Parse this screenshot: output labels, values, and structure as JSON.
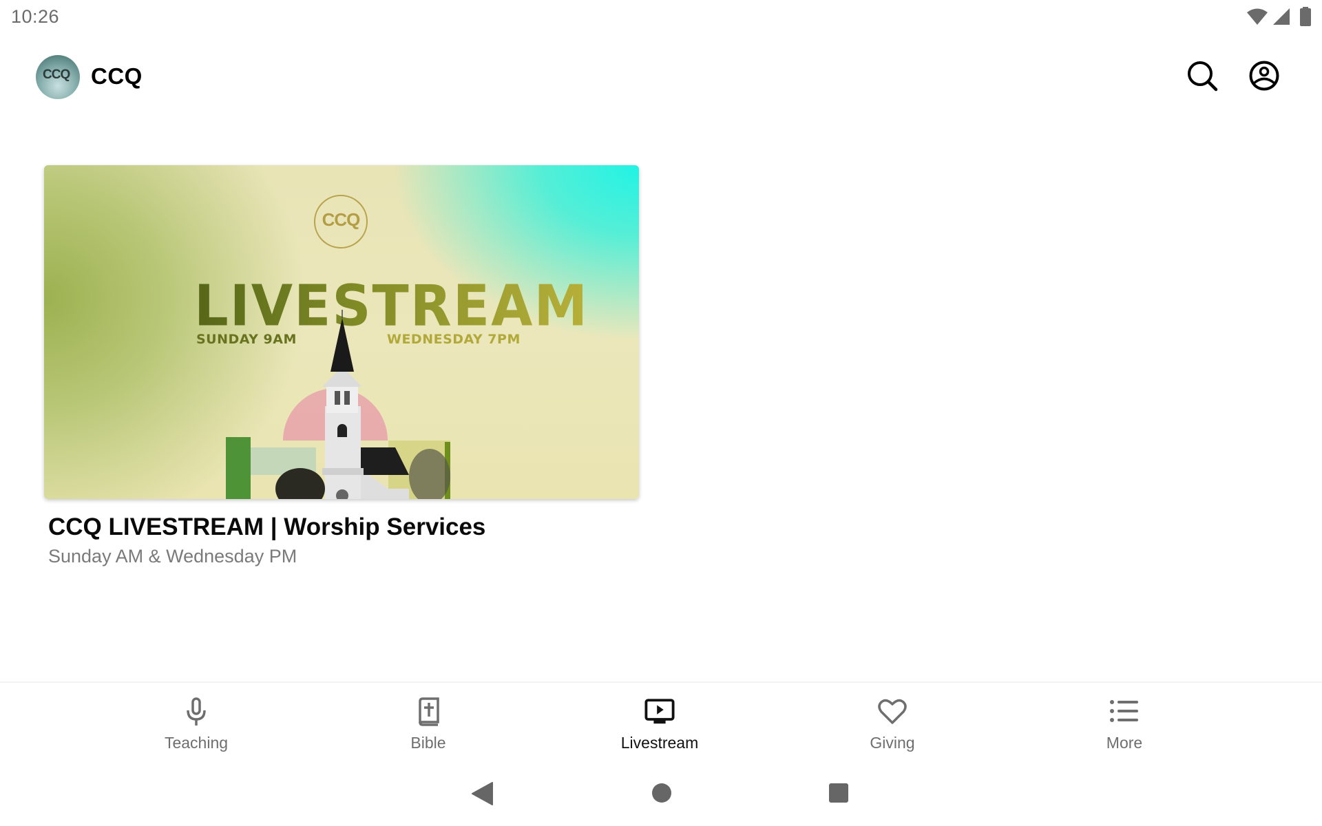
{
  "status_bar": {
    "time": "10:26",
    "icons": [
      "wifi-icon",
      "cell-signal-icon",
      "battery-icon"
    ]
  },
  "app_bar": {
    "logo_text": "CCQ",
    "title": "CCQ",
    "actions": [
      {
        "icon": "search-icon",
        "label": "Search"
      },
      {
        "icon": "account-icon",
        "label": "Profile"
      }
    ]
  },
  "content": {
    "card": {
      "artwork": {
        "logo_text": "CCQ",
        "headline": "LIVESTREAM",
        "left_caption": "SUNDAY 9AM",
        "right_caption": "WEDNESDAY 7PM"
      },
      "title": "CCQ LIVESTREAM | Worship Services",
      "subtitle": "Sunday AM & Wednesday PM"
    }
  },
  "bottom_nav": {
    "active": "Livestream",
    "items": [
      {
        "label": "Teaching",
        "icon": "microphone-icon"
      },
      {
        "label": "Bible",
        "icon": "bible-icon"
      },
      {
        "label": "Livestream",
        "icon": "tv-play-icon"
      },
      {
        "label": "Giving",
        "icon": "heart-icon"
      },
      {
        "label": "More",
        "icon": "list-icon"
      }
    ]
  },
  "system_nav": [
    "back",
    "home",
    "recents"
  ],
  "colors": {
    "inactive": "#6e6e6e",
    "active": "#111111",
    "subtitle": "#7a7a7a"
  }
}
